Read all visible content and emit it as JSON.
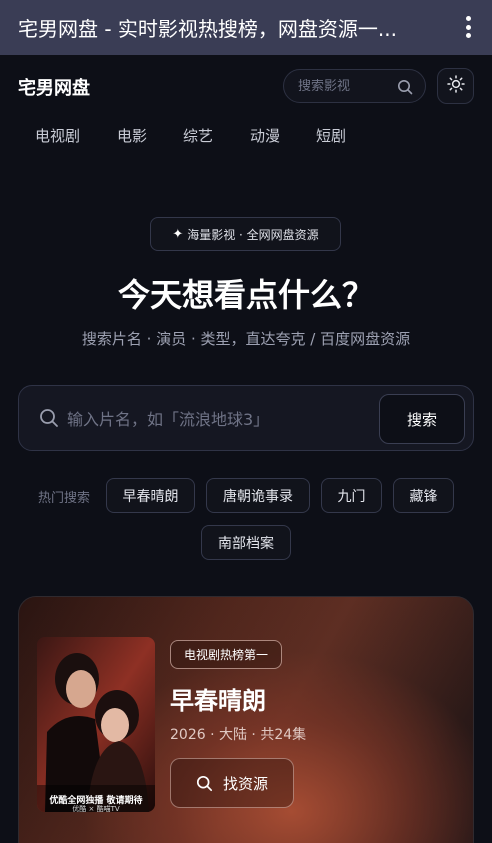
{
  "window": {
    "title": "宅男网盘 - 实时影视热搜榜，网盘资源一...",
    "more_icon": "more-vertical-icon"
  },
  "header": {
    "brand": "宅男网盘",
    "search_placeholder": "搜索影视",
    "search_icon": "search-icon",
    "theme_icon": "sun-icon"
  },
  "nav": {
    "items": [
      {
        "label": "电视剧"
      },
      {
        "label": "电影"
      },
      {
        "label": "综艺"
      },
      {
        "label": "动漫"
      },
      {
        "label": "短剧"
      }
    ]
  },
  "hero": {
    "badge_icon": "sparkle-icon",
    "badge_text": "海量影视 · 全网网盘资源",
    "title": "今天想看点什么？",
    "subtitle": "搜索片名 · 演员 · 类型，直达夸克 / 百度网盘资源",
    "search_placeholder": "输入片名，如「流浪地球3」",
    "search_button": "搜索"
  },
  "hot": {
    "label": "热门搜索",
    "tags": [
      "早春晴朗",
      "唐朝诡事录",
      "九门",
      "藏锋",
      "南部档案"
    ]
  },
  "featured": {
    "tag": "电视剧热榜第一",
    "title": "早春晴朗",
    "meta": "2026 · 大陆 · 共24集",
    "button": "找资源",
    "button_icon": "search-icon",
    "poster": {
      "caption_line1": "优酷全网独播 敬请期待",
      "caption_line2": "优酷 × 酷喵TV"
    },
    "accent": "#a93a2c"
  },
  "colors": {
    "background": "#0d0f17",
    "titlebar": "#3a3d55"
  }
}
